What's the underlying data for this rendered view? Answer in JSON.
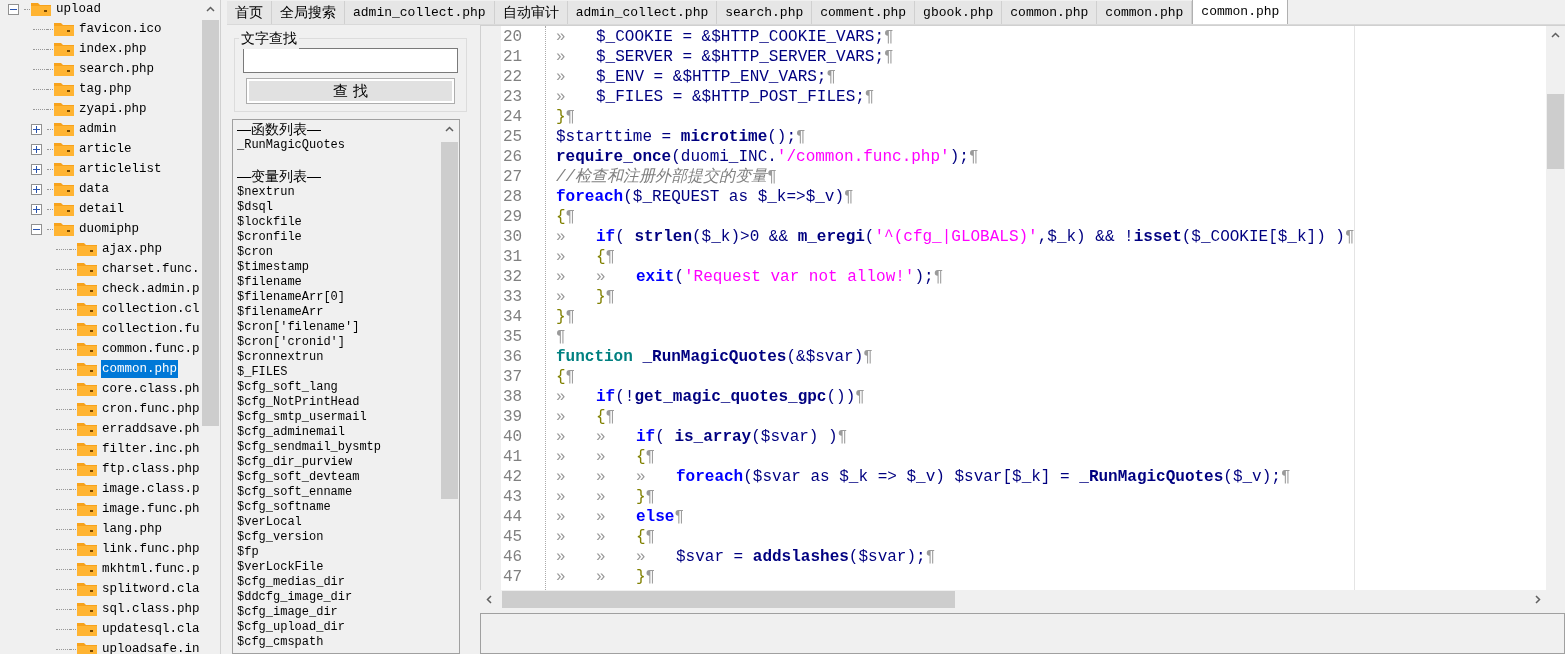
{
  "tree": {
    "items": [
      {
        "label": "upload",
        "expanded": true,
        "selected": false,
        "children": [
          {
            "label": "favicon.ico",
            "selected": false
          },
          {
            "label": "index.php",
            "selected": false
          },
          {
            "label": "search.php",
            "selected": false
          },
          {
            "label": "tag.php",
            "selected": false
          },
          {
            "label": "zyapi.php",
            "selected": false
          },
          {
            "label": "admin",
            "expanded": false,
            "selected": false
          },
          {
            "label": "article",
            "expanded": false,
            "selected": false
          },
          {
            "label": "articlelist",
            "expanded": false,
            "selected": false
          },
          {
            "label": "data",
            "expanded": false,
            "selected": false
          },
          {
            "label": "detail",
            "expanded": false,
            "selected": false
          },
          {
            "label": "duomiphp",
            "expanded": true,
            "selected": false,
            "children": [
              {
                "label": "ajax.php",
                "selected": false
              },
              {
                "label": "charset.func.",
                "selected": false
              },
              {
                "label": "check.admin.p",
                "selected": false
              },
              {
                "label": "collection.cl",
                "selected": false
              },
              {
                "label": "collection.fu",
                "selected": false
              },
              {
                "label": "common.func.p",
                "selected": false
              },
              {
                "label": "common.php",
                "selected": true
              },
              {
                "label": "core.class.ph",
                "selected": false
              },
              {
                "label": "cron.func.php",
                "selected": false
              },
              {
                "label": "erraddsave.ph",
                "selected": false
              },
              {
                "label": "filter.inc.ph",
                "selected": false
              },
              {
                "label": "ftp.class.php",
                "selected": false
              },
              {
                "label": "image.class.p",
                "selected": false
              },
              {
                "label": "image.func.ph",
                "selected": false
              },
              {
                "label": "lang.php",
                "selected": false
              },
              {
                "label": "link.func.php",
                "selected": false
              },
              {
                "label": "mkhtml.func.p",
                "selected": false
              },
              {
                "label": "splitword.cla",
                "selected": false
              },
              {
                "label": "sql.class.php",
                "selected": false
              },
              {
                "label": "updatesql.cla",
                "selected": false
              },
              {
                "label": "uploadsafe.in",
                "selected": false
              }
            ]
          }
        ]
      }
    ]
  },
  "tabs": [
    {
      "label": "首页",
      "selected": false
    },
    {
      "label": "全局搜索",
      "selected": false
    },
    {
      "label": "admin_collect.php",
      "selected": false
    },
    {
      "label": "自动审计",
      "selected": false
    },
    {
      "label": "admin_collect.php",
      "selected": false
    },
    {
      "label": "search.php",
      "selected": false
    },
    {
      "label": "comment.php",
      "selected": false
    },
    {
      "label": "gbook.php",
      "selected": false
    },
    {
      "label": "common.php",
      "selected": false
    },
    {
      "label": "common.php",
      "selected": false
    },
    {
      "label": "common.php",
      "selected": true
    }
  ],
  "text_search": {
    "title": "文字查找",
    "button": "查 找"
  },
  "symbols": {
    "sections": [
      {
        "title": "—函数列表—",
        "items": [
          "_RunMagicQuotes"
        ]
      },
      {
        "title": "—变量列表—",
        "items": [
          "$nextrun",
          "$dsql",
          "$lockfile",
          "$cronfile",
          "$cron",
          "$timestamp",
          "$filename",
          "$filenameArr[0]",
          "$filenameArr",
          "$cron['filename']",
          "$cron['cronid']",
          "$cronnextrun",
          "$_FILES",
          "$cfg_soft_lang",
          "$cfg_NotPrintHead",
          "$cfg_smtp_usermail",
          "$cfg_adminemail",
          "$cfg_sendmail_bysmtp",
          "$cfg_dir_purview",
          "$cfg_soft_devteam",
          "$cfg_soft_enname",
          "$cfg_softname",
          "$verLocal",
          "$cfg_version",
          "$fp",
          "$verLockFile",
          "$cfg_medias_dir",
          "$ddcfg_image_dir",
          "$cfg_image_dir",
          "$cfg_upload_dir",
          "$cfg_cmspath"
        ]
      }
    ]
  },
  "editor": {
    "eol": "¶",
    "lines": [
      {
        "number": "20",
        "tabs": [
          "»"
        ],
        "tokens": [
          {
            "kind": "plain",
            "text": "$_COOKIE = &$HTTP_COOKIE_VARS;"
          }
        ]
      },
      {
        "number": "21",
        "tabs": [
          "»"
        ],
        "tokens": [
          {
            "kind": "plain",
            "text": "$_SERVER = &$HTTP_SERVER_VARS;"
          }
        ]
      },
      {
        "number": "22",
        "tabs": [
          "»"
        ],
        "tokens": [
          {
            "kind": "plain",
            "text": "$_ENV = &$HTTP_ENV_VARS;"
          }
        ]
      },
      {
        "number": "23",
        "tabs": [
          "»"
        ],
        "tokens": [
          {
            "kind": "plain",
            "text": "$_FILES = &$HTTP_POST_FILES;"
          }
        ]
      },
      {
        "number": "24",
        "tokens": [
          {
            "kind": "brace",
            "text": "}"
          }
        ]
      },
      {
        "number": "25",
        "tokens": [
          {
            "kind": "plain",
            "text": "$starttime = "
          },
          {
            "kind": "fn",
            "text": "microtime"
          },
          {
            "kind": "plain",
            "text": "();"
          }
        ]
      },
      {
        "number": "26",
        "tokens": [
          {
            "kind": "fn",
            "text": "require_once"
          },
          {
            "kind": "plain",
            "text": "(duomi_INC."
          },
          {
            "kind": "str",
            "text": "'/common.func.php'"
          },
          {
            "kind": "plain",
            "text": ");"
          }
        ]
      },
      {
        "number": "27",
        "tokens": [
          {
            "kind": "comment",
            "text": "//检查和注册外部提交的变量"
          }
        ]
      },
      {
        "number": "28",
        "tokens": [
          {
            "kind": "kw",
            "text": "foreach"
          },
          {
            "kind": "plain",
            "text": "($_REQUEST as $_k=>$_v)"
          }
        ]
      },
      {
        "number": "29",
        "tokens": [
          {
            "kind": "brace",
            "text": "{"
          }
        ]
      },
      {
        "number": "30",
        "tabs": [
          "»"
        ],
        "tokens": [
          {
            "kind": "kw",
            "text": "if"
          },
          {
            "kind": "plain",
            "text": "( "
          },
          {
            "kind": "fn",
            "text": "strlen"
          },
          {
            "kind": "plain",
            "text": "($_k)>0 && "
          },
          {
            "kind": "fn",
            "text": "m_eregi"
          },
          {
            "kind": "plain",
            "text": "("
          },
          {
            "kind": "str",
            "text": "'^(cfg_|GLOBALS)'"
          },
          {
            "kind": "plain",
            "text": ",$_k) && !"
          },
          {
            "kind": "fn",
            "text": "isset"
          },
          {
            "kind": "plain",
            "text": "($_COOKIE[$_k]) )"
          }
        ]
      },
      {
        "number": "31",
        "tabs": [
          "»"
        ],
        "tokens": [
          {
            "kind": "brace",
            "text": "{"
          }
        ]
      },
      {
        "number": "32",
        "tabs": [
          "»",
          "»"
        ],
        "tokens": [
          {
            "kind": "kw",
            "text": "exit"
          },
          {
            "kind": "plain",
            "text": "("
          },
          {
            "kind": "str",
            "text": "'Request var not allow!'"
          },
          {
            "kind": "plain",
            "text": ");"
          }
        ]
      },
      {
        "number": "33",
        "tabs": [
          "»"
        ],
        "tokens": [
          {
            "kind": "brace",
            "text": "}"
          }
        ]
      },
      {
        "number": "34",
        "tokens": [
          {
            "kind": "brace",
            "text": "}"
          }
        ]
      },
      {
        "number": "35"
      },
      {
        "number": "36",
        "tokens": [
          {
            "kind": "decl",
            "text": "function "
          },
          {
            "kind": "fn",
            "text": "_RunMagicQuotes"
          },
          {
            "kind": "plain",
            "text": "(&$svar)"
          }
        ]
      },
      {
        "number": "37",
        "tokens": [
          {
            "kind": "brace",
            "text": "{"
          }
        ]
      },
      {
        "number": "38",
        "tabs": [
          "»"
        ],
        "tokens": [
          {
            "kind": "kw",
            "text": "if"
          },
          {
            "kind": "plain",
            "text": "(!"
          },
          {
            "kind": "fn",
            "text": "get_magic_quotes_gpc"
          },
          {
            "kind": "plain",
            "text": "())"
          }
        ]
      },
      {
        "number": "39",
        "tabs": [
          "»"
        ],
        "tokens": [
          {
            "kind": "brace",
            "text": "{"
          }
        ]
      },
      {
        "number": "40",
        "tabs": [
          "»",
          "»"
        ],
        "tokens": [
          {
            "kind": "kw",
            "text": "if"
          },
          {
            "kind": "plain",
            "text": "( "
          },
          {
            "kind": "fn",
            "text": "is_array"
          },
          {
            "kind": "plain",
            "text": "($svar) )"
          }
        ]
      },
      {
        "number": "41",
        "tabs": [
          "»",
          "»"
        ],
        "tokens": [
          {
            "kind": "brace",
            "text": "{"
          }
        ]
      },
      {
        "number": "42",
        "tabs": [
          "»",
          "»",
          "»"
        ],
        "tokens": [
          {
            "kind": "kw",
            "text": "foreach"
          },
          {
            "kind": "plain",
            "text": "($svar as $_k => $_v) $svar[$_k] = "
          },
          {
            "kind": "fn",
            "text": "_RunMagicQuotes"
          },
          {
            "kind": "plain",
            "text": "($_v);"
          }
        ]
      },
      {
        "number": "43",
        "tabs": [
          "»",
          "»"
        ],
        "tokens": [
          {
            "kind": "brace",
            "text": "}"
          }
        ]
      },
      {
        "number": "44",
        "tabs": [
          "»",
          "»"
        ],
        "tokens": [
          {
            "kind": "kw",
            "text": "else"
          }
        ]
      },
      {
        "number": "45",
        "tabs": [
          "»",
          "»"
        ],
        "tokens": [
          {
            "kind": "brace",
            "text": "{"
          }
        ]
      },
      {
        "number": "46",
        "tabs": [
          "»",
          "»",
          "»"
        ],
        "tokens": [
          {
            "kind": "plain",
            "text": "$svar = "
          },
          {
            "kind": "fn",
            "text": "addslashes"
          },
          {
            "kind": "plain",
            "text": "($svar);"
          }
        ]
      },
      {
        "number": "47",
        "tabs": [
          "»",
          "»"
        ],
        "tokens": [
          {
            "kind": "brace",
            "text": "}"
          }
        ]
      }
    ]
  }
}
